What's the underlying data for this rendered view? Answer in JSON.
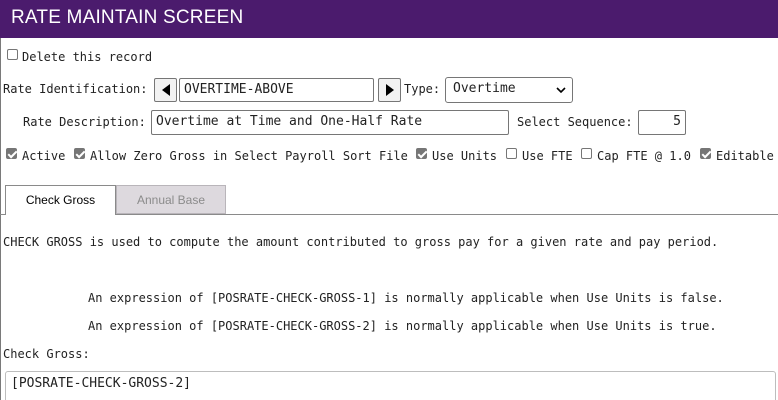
{
  "header": {
    "title": "RATE MAINTAIN SCREEN"
  },
  "delete_record": {
    "label": "Delete this record",
    "checked": false
  },
  "rate_identification": {
    "label": "Rate Identification:",
    "value": "OVERTIME-ABOVE",
    "prev_icon": "triangle-left-icon",
    "next_icon": "triangle-right-icon"
  },
  "type": {
    "label": "Type:",
    "value": "Overtime"
  },
  "rate_description": {
    "label": "Rate Description:",
    "value": "Overtime at Time and One-Half Rate"
  },
  "select_sequence": {
    "label": "Select Sequence:",
    "value": "5"
  },
  "options": {
    "active": {
      "label": "Active",
      "checked": true
    },
    "allow_zero_gross": {
      "label": "Allow Zero Gross in Select Payroll Sort File",
      "checked": true
    },
    "use_units": {
      "label": "Use Units",
      "checked": true
    },
    "use_fte": {
      "label": "Use FTE",
      "checked": false
    },
    "cap_fte": {
      "label": "Cap FTE @ 1.0",
      "checked": false
    },
    "editable": {
      "label": "Editable",
      "checked": true
    }
  },
  "tabs": [
    {
      "label": "Check Gross",
      "active": true
    },
    {
      "label": "Annual Base",
      "active": false
    }
  ],
  "content": {
    "description": "CHECK GROSS is used to compute the amount contributed to gross pay for a given rate and pay period.",
    "expression_1": "An expression of [POSRATE-CHECK-GROSS-1] is normally applicable when Use Units is false.",
    "expression_2": "An expression of [POSRATE-CHECK-GROSS-2] is normally applicable when Use Units is true.",
    "field_label": "Check Gross:",
    "field_value": "[POSRATE-CHECK-GROSS-2]"
  },
  "colors": {
    "header_bg": "#4b1b6d",
    "header_text": "#ffffff",
    "inactive_tab_bg": "#ddd9de"
  }
}
